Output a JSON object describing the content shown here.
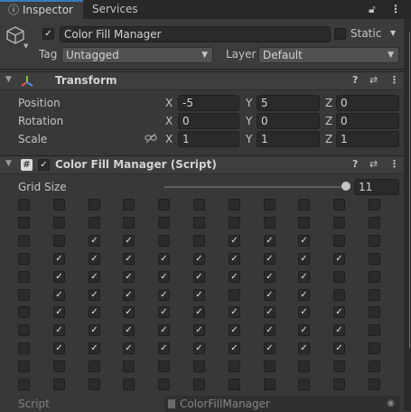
{
  "tabs": {
    "inspector": "Inspector",
    "services": "Services",
    "inspector_icon": "info-circle-icon",
    "lock_icon": "lock-icon",
    "menu_icon": "kebab-menu-icon"
  },
  "gameobject": {
    "active": true,
    "name": "Color Fill Manager",
    "static_label": "Static",
    "static_checked": false,
    "tag_label": "Tag",
    "tag_value": "Untagged",
    "layer_label": "Layer",
    "layer_value": "Default",
    "icon": "cube-icon"
  },
  "transform": {
    "title": "Transform",
    "position_label": "Position",
    "rotation_label": "Rotation",
    "scale_label": "Scale",
    "axes": [
      "X",
      "Y",
      "Z"
    ],
    "position": [
      "-5",
      "5",
      "0"
    ],
    "rotation": [
      "0",
      "0",
      "0"
    ],
    "scale": [
      "1",
      "1",
      "1"
    ],
    "icons": [
      "help-icon",
      "preset-icon",
      "kebab-menu-icon"
    ]
  },
  "script_component": {
    "title": "Color Fill Manager (Script)",
    "enabled": true,
    "grid_size_label": "Grid Size",
    "grid_size_value": "11",
    "grid_size_fraction": 1.0,
    "script_label": "Script",
    "script_value": "ColorFillManager",
    "grid": [
      [
        0,
        0,
        0,
        0,
        0,
        0,
        0,
        0,
        0,
        0,
        0
      ],
      [
        0,
        0,
        0,
        0,
        0,
        0,
        0,
        0,
        0,
        0,
        0
      ],
      [
        0,
        0,
        1,
        1,
        0,
        0,
        1,
        1,
        1,
        0,
        0
      ],
      [
        0,
        1,
        1,
        1,
        1,
        1,
        1,
        1,
        1,
        1,
        0
      ],
      [
        0,
        1,
        1,
        1,
        1,
        1,
        1,
        1,
        1,
        0,
        0
      ],
      [
        0,
        1,
        1,
        1,
        1,
        1,
        0,
        1,
        1,
        0,
        0
      ],
      [
        0,
        1,
        1,
        1,
        1,
        1,
        1,
        1,
        1,
        1,
        0
      ],
      [
        0,
        1,
        1,
        1,
        1,
        1,
        1,
        1,
        1,
        1,
        0
      ],
      [
        0,
        1,
        1,
        1,
        1,
        1,
        1,
        1,
        1,
        1,
        0
      ],
      [
        0,
        0,
        0,
        0,
        0,
        0,
        0,
        0,
        0,
        0,
        0
      ],
      [
        0,
        0,
        0,
        0,
        0,
        0,
        0,
        0,
        0,
        0,
        0
      ]
    ]
  },
  "colors": {
    "background": "#383838",
    "field": "#2a2a2a",
    "accent": "#3a79bb"
  }
}
